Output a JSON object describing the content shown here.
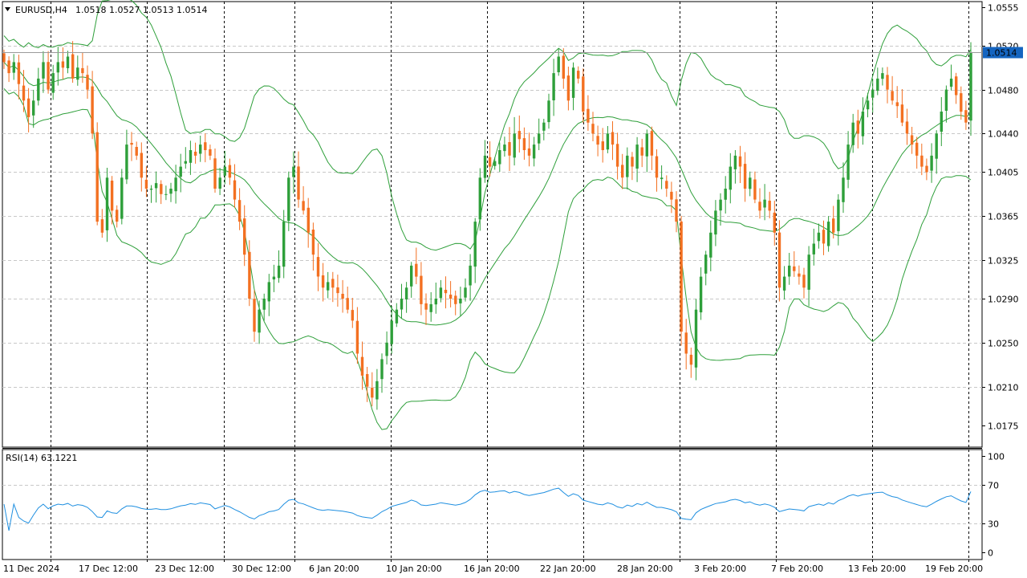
{
  "window": {
    "header_symbol": "EURUSD,H4",
    "header_ohlc": "1.0518 1.0527 1.0513 1.0514",
    "collapse_icon": "triangle-down-icon"
  },
  "colors": {
    "bull": "#2e9f3a",
    "bear": "#f37021",
    "band": "#2e9f3a",
    "rsi": "#1f8fe0",
    "price_tag_bg": "#1565c0",
    "grid": "#c8c8c8",
    "separator": "#000000"
  },
  "chart_data": [
    {
      "type": "candlestick",
      "title": "EURUSD,H4",
      "symbol": "EURUSD",
      "timeframe": "H4",
      "last_price": "1.0514",
      "ylim": [
        1.0155,
        1.056
      ],
      "y_ticks": [
        "1.0555",
        "1.0520",
        "1.0480",
        "1.0440",
        "1.0405",
        "1.0365",
        "1.0325",
        "1.0290",
        "1.0250",
        "1.0210",
        "1.0175"
      ],
      "x_ticks": [
        "11 Dec 2024",
        "17 Dec 12:00",
        "23 Dec 12:00",
        "30 Dec 12:00",
        "6 Jan 20:00",
        "10 Jan 20:00",
        "16 Jan 20:00",
        "22 Jan 20:00",
        "28 Jan 20:00",
        "3 Feb 20:00",
        "7 Feb 20:00",
        "13 Feb 20:00",
        "19 Feb 20:00"
      ],
      "indicator": "Bollinger Bands",
      "close_series": [
        1.0505,
        1.0495,
        1.0505,
        1.0485,
        1.047,
        1.0455,
        1.047,
        1.049,
        1.0505,
        1.048,
        1.0495,
        1.0505,
        1.05,
        1.051,
        1.049,
        1.05,
        1.0495,
        1.048,
        1.044,
        1.036,
        1.035,
        1.04,
        1.037,
        1.036,
        1.04,
        1.043,
        1.043,
        1.042,
        1.04,
        1.039,
        1.039,
        1.0395,
        1.0385,
        1.0385,
        1.039,
        1.04,
        1.041,
        1.0415,
        1.0425,
        1.042,
        1.043,
        1.0425,
        1.042,
        1.039,
        1.04,
        1.041,
        1.04,
        1.038,
        1.036,
        1.033,
        1.029,
        1.026,
        1.028,
        1.029,
        1.0305,
        1.031,
        1.032,
        1.036,
        1.04,
        1.041,
        1.038,
        1.037,
        1.035,
        1.033,
        1.031,
        1.03,
        1.0305,
        1.03,
        1.0295,
        1.029,
        1.028,
        1.027,
        1.024,
        1.022,
        1.021,
        1.02,
        1.0215,
        1.0235,
        1.025,
        1.027,
        1.028,
        1.029,
        1.03,
        1.032,
        1.031,
        1.0285,
        1.028,
        1.0285,
        1.029,
        1.03,
        1.0295,
        1.029,
        1.0285,
        1.029,
        1.03,
        1.032,
        1.036,
        1.04,
        1.042,
        1.041,
        1.0415,
        1.0425,
        1.043,
        1.042,
        1.044,
        1.0435,
        1.0425,
        1.042,
        1.043,
        1.044,
        1.045,
        1.047,
        1.0495,
        1.051,
        1.049,
        1.047,
        1.05,
        1.049,
        1.046,
        1.045,
        1.044,
        1.043,
        1.0425,
        1.044,
        1.043,
        1.041,
        1.04,
        1.042,
        1.041,
        1.043,
        1.042,
        1.044,
        1.042,
        1.04,
        1.04,
        1.039,
        1.038,
        1.036,
        1.026,
        1.024,
        1.023,
        1.028,
        1.031,
        1.033,
        1.035,
        1.037,
        1.038,
        1.039,
        1.041,
        1.042,
        1.041,
        1.039,
        1.04,
        1.038,
        1.037,
        1.038,
        1.037,
        1.035,
        1.03,
        1.031,
        1.032,
        1.0315,
        1.031,
        1.03,
        1.033,
        1.034,
        1.035,
        1.034,
        1.036,
        1.035,
        1.038,
        1.04,
        1.043,
        1.045,
        1.044,
        1.046,
        1.047,
        1.048,
        1.049,
        1.0495,
        1.048,
        1.047,
        1.0465,
        1.045,
        1.044,
        1.043,
        1.042,
        1.041,
        1.0405,
        1.042,
        1.044,
        1.046,
        1.048,
        1.049,
        1.0475,
        1.046,
        1.045,
        1.0514
      ]
    },
    {
      "type": "line",
      "title": "RSI(14) 63.1221",
      "name": "RSI(14)",
      "value": "63.1221",
      "ylim": [
        0,
        100
      ],
      "y_ticks": [
        "100",
        "70",
        "30",
        "0"
      ],
      "levels": [
        70,
        30
      ]
    }
  ]
}
